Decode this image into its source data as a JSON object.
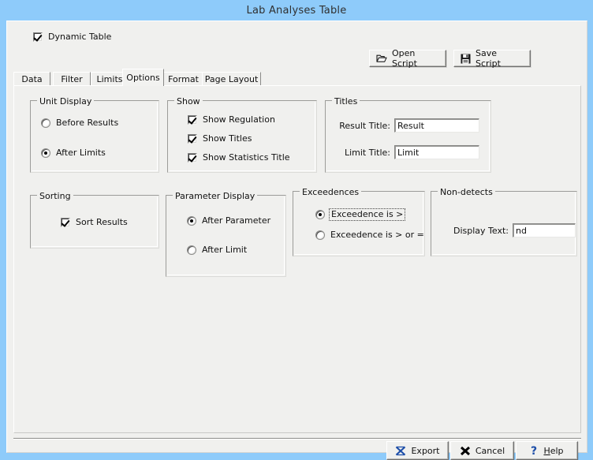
{
  "window": {
    "title": "Lab Analyses Table",
    "titlebar_color": "#8ecbfa",
    "face_color": "#f0f0ee"
  },
  "toolbar": {
    "dynamic_table_label": "Dynamic Table",
    "dynamic_table_checked": true,
    "open_script_label": "Open Script",
    "save_script_label": "Save Script"
  },
  "tabs": [
    {
      "label": "Data",
      "selected": false
    },
    {
      "label": "Filter",
      "selected": false
    },
    {
      "label": "Limits",
      "selected": false
    },
    {
      "label": "Options",
      "selected": true
    },
    {
      "label": "Format",
      "selected": false
    },
    {
      "label": "Page Layout",
      "selected": false
    }
  ],
  "groups": {
    "unit_display": {
      "title": "Unit Display",
      "options": [
        {
          "label": "Before Results",
          "selected": false
        },
        {
          "label": "After Limits",
          "selected": true
        }
      ]
    },
    "show": {
      "title": "Show",
      "options": [
        {
          "label": "Show Regulation",
          "checked": true
        },
        {
          "label": "Show Titles",
          "checked": true
        },
        {
          "label": "Show Statistics Title",
          "checked": true
        }
      ]
    },
    "titles": {
      "title": "Titles",
      "fields": [
        {
          "label": "Result Title:",
          "value": "Result"
        },
        {
          "label": "Limit Title:",
          "value": "Limit"
        }
      ]
    },
    "sorting": {
      "title": "Sorting",
      "options": [
        {
          "label": "Sort Results",
          "checked": true
        }
      ]
    },
    "parameter_display": {
      "title": "Parameter Display",
      "options": [
        {
          "label": "After Parameter",
          "selected": true
        },
        {
          "label": "After Limit",
          "selected": false
        }
      ]
    },
    "exceedences": {
      "title": "Exceedences",
      "options": [
        {
          "label": "Exceedence is >",
          "selected": true,
          "focused": true
        },
        {
          "label": "Exceedence is > or =",
          "selected": false,
          "focused": false
        }
      ]
    },
    "non_detects": {
      "title": "Non-detects",
      "fields": [
        {
          "label": "Display Text:",
          "value": "nd"
        }
      ]
    }
  },
  "footer": {
    "export_label": "Export",
    "cancel_label": "Cancel",
    "help_label_prefix": "H",
    "help_label_rest": "elp"
  }
}
